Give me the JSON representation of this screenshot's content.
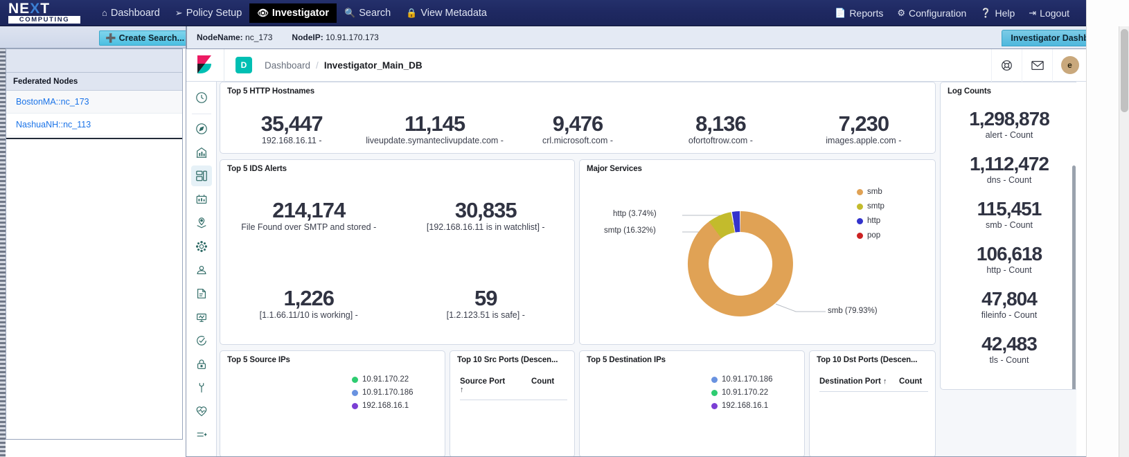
{
  "topnav": {
    "logo": {
      "next": "NE",
      "x": "X",
      "t": "T",
      "sub": "COMPUTING"
    },
    "left_items": [
      {
        "label": "Dashboard",
        "icon": "home-icon",
        "glyph": "⌂",
        "active": false
      },
      {
        "label": "Policy Setup",
        "icon": "wrench-icon",
        "glyph": "⚒",
        "active": false
      },
      {
        "label": "Investigator",
        "icon": "eye-icon",
        "glyph": "◉",
        "active": true
      },
      {
        "label": "Search",
        "icon": "search-icon",
        "glyph": "⌕",
        "active": false
      },
      {
        "label": "View Metadata",
        "icon": "lock-icon",
        "glyph": "⚿",
        "active": false
      }
    ],
    "right_items": [
      {
        "label": "Reports",
        "icon": "document-icon",
        "glyph": "὜E"
      },
      {
        "label": "Configuration",
        "icon": "gear-icon",
        "glyph": "⚙"
      },
      {
        "label": "Help",
        "icon": "help-circle-icon",
        "glyph": "?"
      },
      {
        "label": "Logout",
        "icon": "logout-icon",
        "glyph": "↪"
      }
    ]
  },
  "subbar": {
    "create_search_label": "Create Search...",
    "node_name_label": "NodeName:",
    "node_name_value": "nc_173",
    "node_ip_label": "NodeIP:",
    "node_ip_value": "10.91.170.173",
    "investigator_tab": "Investigator Dashboard"
  },
  "left_panel": {
    "section_title": "Federated Nodes",
    "nodes": [
      {
        "label": "BostonMA::nc_173"
      },
      {
        "label": "NashuaNH::nc_113"
      }
    ]
  },
  "kibana": {
    "db_badge": "D",
    "breadcrumb_root": "Dashboard",
    "breadcrumb_sep": "/",
    "breadcrumb_current": "Investigator_Main_DB",
    "header_icons": [
      {
        "name": "help-lifebuoy-icon"
      },
      {
        "name": "newsfeed-mail-icon"
      }
    ],
    "avatar_initial": "e",
    "avatar_color": "#c9a87c",
    "rail_icons": [
      {
        "name": "recently-viewed-clock-icon"
      },
      {
        "name": "discover-compass-icon"
      },
      {
        "name": "visualize-barchart-icon"
      },
      {
        "name": "dashboard-icon",
        "selected": true
      },
      {
        "name": "canvas-icon"
      },
      {
        "name": "maps-layers-icon"
      },
      {
        "name": "machine-learning-icon"
      },
      {
        "name": "apm-user-icon"
      },
      {
        "name": "logs-icon"
      },
      {
        "name": "metrics-icon"
      },
      {
        "name": "uptime-icon"
      },
      {
        "name": "security-lock-icon"
      },
      {
        "name": "dev-tools-wrench-icon"
      },
      {
        "name": "monitoring-heartbeat-icon"
      },
      {
        "name": "collapse-arrow-icon"
      }
    ]
  },
  "panels": {
    "http_hostnames": {
      "title": "Top 5 HTTP Hostnames",
      "metrics": [
        {
          "value": "35,447",
          "label": "192.168.16.11 -"
        },
        {
          "value": "11,145",
          "label": "liveupdate.symanteclivupdate.com -"
        },
        {
          "value": "9,476",
          "label": "crl.microsoft.com -"
        },
        {
          "value": "8,136",
          "label": "ofortoftrow.com -"
        },
        {
          "value": "7,230",
          "label": "images.apple.com -"
        }
      ]
    },
    "ids_alerts": {
      "title": "Top 5 IDS Alerts",
      "metrics": [
        {
          "value": "214,174",
          "label": "File Found over SMTP and stored -"
        },
        {
          "value": "30,835",
          "label": "[192.168.16.11 is in watchlist] -"
        },
        {
          "value": "1,226",
          "label": "[1.1.66.11/10 is working] -"
        },
        {
          "value": "59",
          "label": "[1.2.123.51 is safe] -"
        }
      ]
    },
    "major_services": {
      "title": "Major Services"
    },
    "log_counts": {
      "title": "Log Counts",
      "items": [
        {
          "value": "1,298,878",
          "label": "alert - Count"
        },
        {
          "value": "1,112,472",
          "label": "dns - Count"
        },
        {
          "value": "115,451",
          "label": "smb - Count"
        },
        {
          "value": "106,618",
          "label": "http - Count"
        },
        {
          "value": "47,804",
          "label": "fileinfo - Count"
        },
        {
          "value": "42,483",
          "label": "tls - Count"
        }
      ]
    },
    "source_ips": {
      "title": "Top 5 Source IPs",
      "items": [
        {
          "label": "10.91.170.22",
          "color": "#2ecc71"
        },
        {
          "label": "10.91.170.186",
          "color": "#6992e0"
        },
        {
          "label": "192.168.16.1",
          "color": "#7b3fd4"
        }
      ]
    },
    "src_ports": {
      "title": "Top 10 Src Ports (Descen...",
      "col_port": "Source Port",
      "col_count": "Count",
      "sort_arrow": "↑"
    },
    "dest_ips": {
      "title": "Top 5 Destination IPs",
      "items": [
        {
          "label": "10.91.170.186",
          "color": "#6992e0"
        },
        {
          "label": "10.91.170.22",
          "color": "#2ecc71"
        },
        {
          "label": "192.168.16.1",
          "color": "#7b3fd4"
        }
      ]
    },
    "dst_ports": {
      "title": "Top 10 Dst Ports (Descen...",
      "col_port": "Destination Port",
      "col_count": "Count",
      "sort_arrow": "↑"
    }
  },
  "chart_data": {
    "type": "pie",
    "title": "Major Services",
    "donut": true,
    "categories": [
      "smb",
      "smtp",
      "http",
      "pop"
    ],
    "values": [
      79.93,
      16.32,
      3.74,
      0.01
    ],
    "unit": "%",
    "colors": [
      "#e0a255",
      "#c3bb2c",
      "#3333cc",
      "#cc2222"
    ],
    "legend": [
      "smb",
      "smtp",
      "http",
      "pop"
    ],
    "legend_position": "right",
    "annotations": [
      {
        "text": "http (3.74%)",
        "slice": "http"
      },
      {
        "text": "smtp (16.32%)",
        "slice": "smtp"
      },
      {
        "text": "smb (79.93%)",
        "slice": "smb"
      }
    ]
  }
}
